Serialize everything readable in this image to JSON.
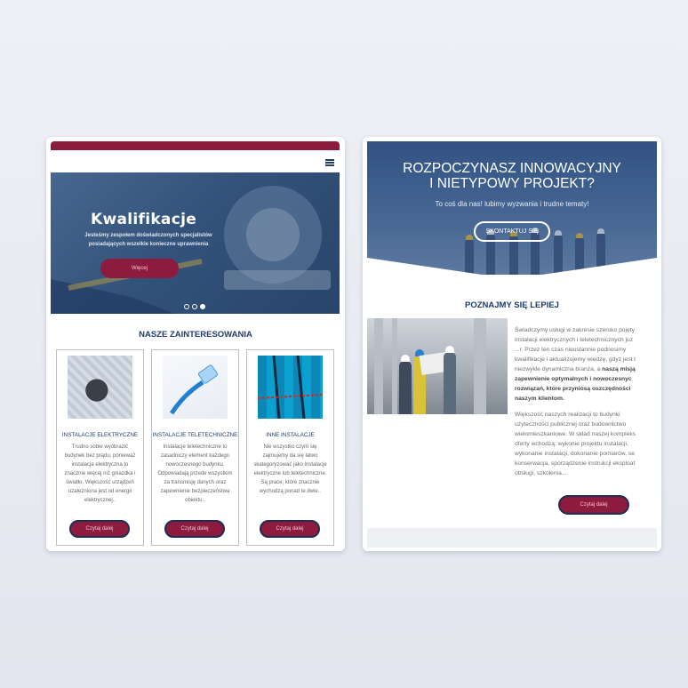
{
  "left_card": {
    "hero": {
      "title": "Kwalifikacje",
      "subtitle": "Jesteśmy zespołem doświadczonych specjalistów posiadających wszelkie konieczne uprawnienia",
      "button": "Więcej",
      "slides_count": 3,
      "active_slide": 3
    },
    "section_title": "NASZE ZAINTERESOWANIA",
    "interests": [
      {
        "title": "INSTALACJE ELEKTRYCZNE",
        "desc": "Trudno sobie wyobrazić budynek bez prądu, ponieważ instalacja elektryczna to znacznie więcej niż gniazdka i światło. Większość urządzeń uzależniona jest od energii elektrycznej..",
        "button": "Czytaj dalej"
      },
      {
        "title": "INSTALACJE TELETECHNICZNE",
        "desc": "Instalacje teletechniczne to zasadniczy element każdego nowoczesnego budynku. Odpowiadają przede wszystkim za transmisję danych oraz zapewnienie bezpieczeństwa obiektu..",
        "button": "Czytaj dalej"
      },
      {
        "title": "INNE INSTALACJE",
        "desc": "Nie wszystko czym się zajmujemy da się łatwo skategoryzować jako instalacje elektryczne lub teletechniczne. Są prace, które znacznie wychodzą ponad te dwie..",
        "button": "Czytaj dalej"
      }
    ]
  },
  "right_card": {
    "hero": {
      "title_line1": "ROZPOCZYNASZ INNOWACYJNY",
      "title_line2": "I NIETYPOWY PROJEKT?",
      "subtitle": "To coś dla nas! lubimy wyzwania i trudne tematy!",
      "button": "SKONTAKTUJ SIĘ"
    },
    "section_title": "POZNAJMY SIĘ LEPIEJ",
    "about": {
      "lines_p1": [
        "Świadczymy usługi w zakresie szeroko pojęty",
        "instalacji elektrycznych i teletechnicznych juz",
        "...r. Przez ten czas nieustannie podnosimy",
        "kwalifikacje i aktualizujemy wiedzę, gdyż jest t",
        "niezwykle dynamiczna branża, a"
      ],
      "p1_bold_inline": "naszą misją",
      "lines_p1_bold": [
        "zapewnienie optymalnych i nowoczesnyc",
        "rozwiązań, które przyniosą oszczędności",
        "naszym klientom."
      ],
      "lines_p2": [
        "Większość naszych realizacji to budynki",
        "użyteczności publicznej oraz budownictwo",
        "wielomieszkaniowe. W skład naszej kompleks",
        "oferty wchodzą: wykonie projektu instalacji,",
        "wykonanie instalacji, dokonanie pomiarów, se",
        "konserwacja, sporządzenie instrukcji eksploat",
        "obsługi, szkolenia..."
      ],
      "button": "Czytaj dalej"
    }
  },
  "colors": {
    "brand_maroon": "#8d1b3d",
    "brand_navy": "#1d3d6f"
  },
  "icons": {
    "menu": "hamburger-menu-icon"
  }
}
